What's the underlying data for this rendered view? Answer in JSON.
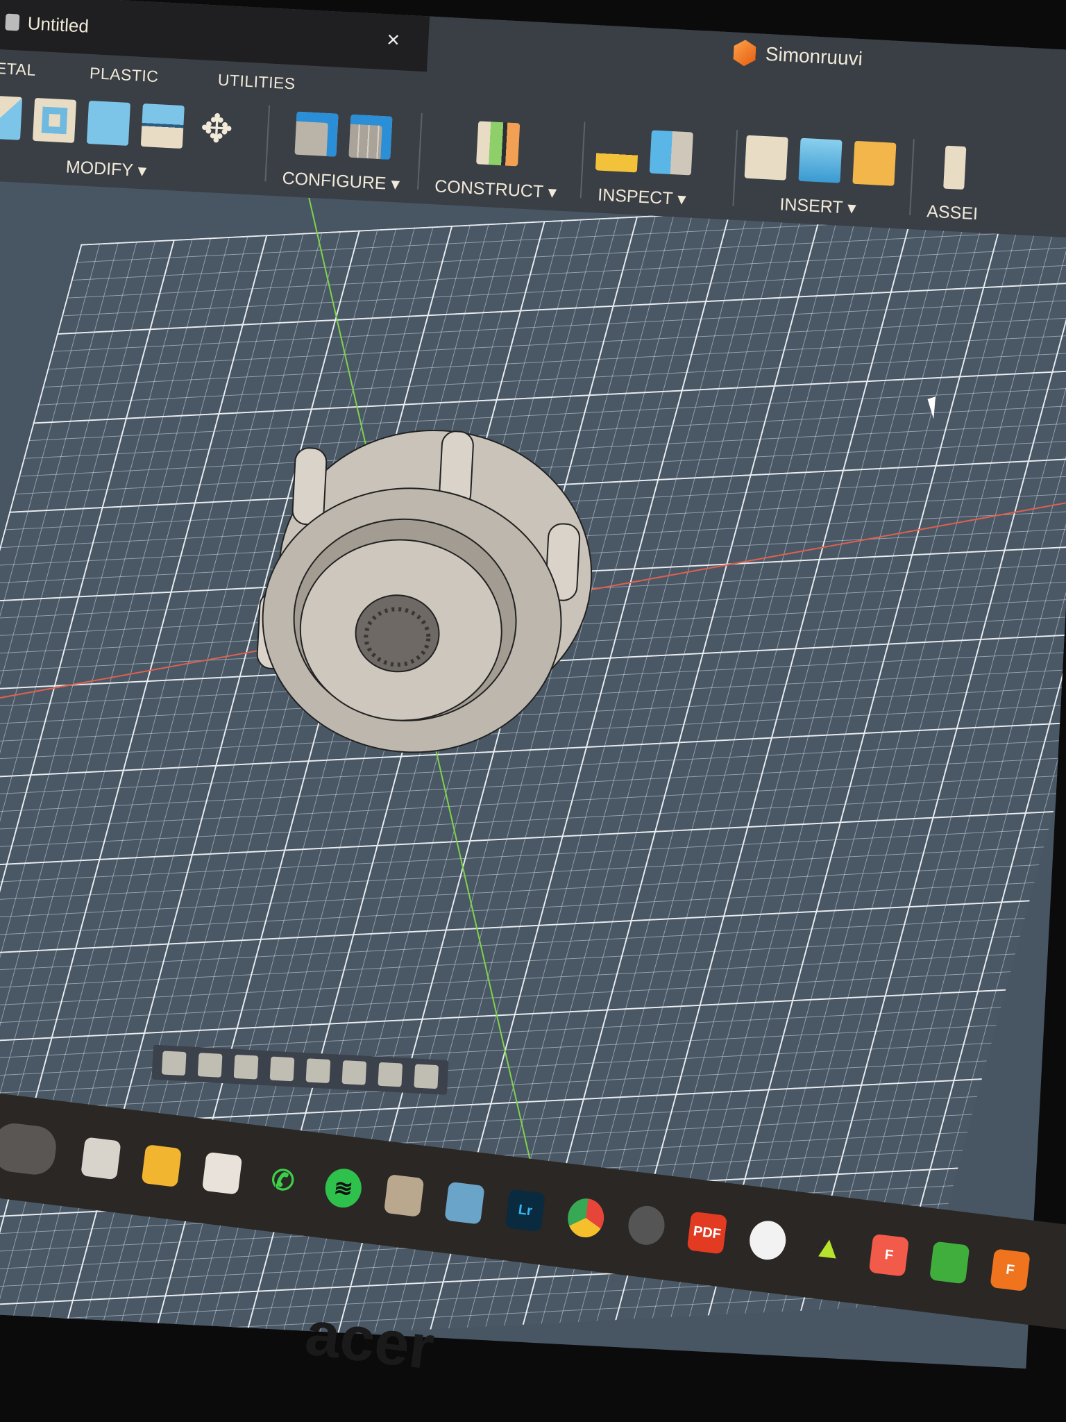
{
  "tabs": [
    {
      "label": "Untitled",
      "active": false
    },
    {
      "label": "Simonruuvi",
      "active": true
    }
  ],
  "close_icon": "×",
  "workspace_tabs": [
    "METAL",
    "PLASTIC",
    "UTILITIES"
  ],
  "groups": [
    {
      "label": "MODIFY ▾"
    },
    {
      "label": "CONFIGURE ▾"
    },
    {
      "label": "CONSTRUCT ▾"
    },
    {
      "label": "INSPECT ▾"
    },
    {
      "label": "INSERT ▾"
    },
    {
      "label": "ASSEI"
    }
  ],
  "taskbar": {
    "apps": [
      {
        "name": "task-view",
        "text": "",
        "color": "#d9d4cb"
      },
      {
        "name": "file-explorer",
        "text": "",
        "color": "#f2b530"
      },
      {
        "name": "microsoft-store",
        "text": "",
        "color": "#e8e2da"
      },
      {
        "name": "whatsapp",
        "text": "✆",
        "color": "#3bd14a"
      },
      {
        "name": "spotify",
        "text": "≋",
        "color": "#2ec24c"
      },
      {
        "name": "photo-app",
        "text": "",
        "color": "#b9a88e"
      },
      {
        "name": "avatar-app",
        "text": "",
        "color": "#6aa4c8"
      },
      {
        "name": "lightroom",
        "text": "Lr",
        "color": "#0a2a40"
      },
      {
        "name": "chrome",
        "text": "",
        "color": "#e7453a"
      },
      {
        "name": "camera",
        "text": "",
        "color": "#555"
      },
      {
        "name": "pdf",
        "text": "PDF",
        "color": "#e33a22"
      },
      {
        "name": "github",
        "text": "",
        "color": "#f2f2f2"
      },
      {
        "name": "arrow-app",
        "text": "▲",
        "color": "#2b2725"
      },
      {
        "name": "figma-like",
        "text": "F",
        "color": "#f25b4a"
      },
      {
        "name": "green-app",
        "text": "",
        "color": "#3fae3c"
      },
      {
        "name": "fusion",
        "text": "F",
        "color": "#f0731e"
      }
    ]
  },
  "bezel_logo": "acer"
}
